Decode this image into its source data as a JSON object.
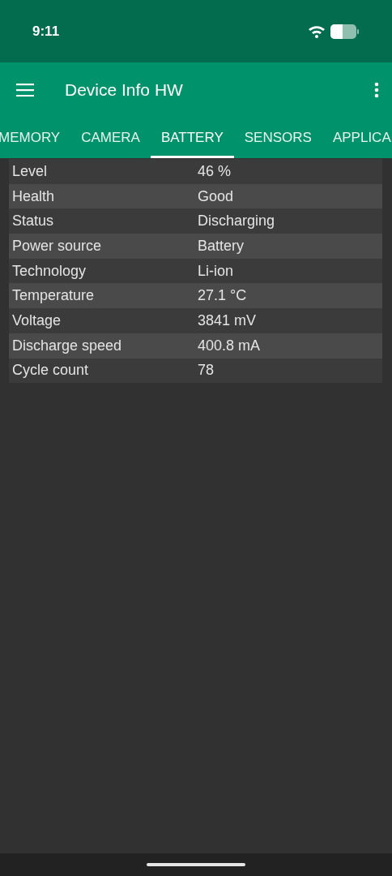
{
  "status_bar": {
    "time": "9:11"
  },
  "app_bar": {
    "title": "Device Info HW"
  },
  "tabs": [
    {
      "label": "MEMORY",
      "selected": false
    },
    {
      "label": "CAMERA",
      "selected": false
    },
    {
      "label": "BATTERY",
      "selected": true
    },
    {
      "label": "SENSORS",
      "selected": false
    },
    {
      "label": "APPLICA",
      "selected": false
    }
  ],
  "rows": [
    {
      "label": "Level",
      "value": "46 %"
    },
    {
      "label": "Health",
      "value": "Good"
    },
    {
      "label": "Status",
      "value": "Discharging"
    },
    {
      "label": "Power source",
      "value": "Battery"
    },
    {
      "label": "Technology",
      "value": "Li-ion"
    },
    {
      "label": "Temperature",
      "value": "27.1 °C"
    },
    {
      "label": "Voltage",
      "value": "3841 mV"
    },
    {
      "label": "Discharge speed",
      "value": "400.8 mA"
    },
    {
      "label": "Cycle count",
      "value": "78"
    }
  ]
}
